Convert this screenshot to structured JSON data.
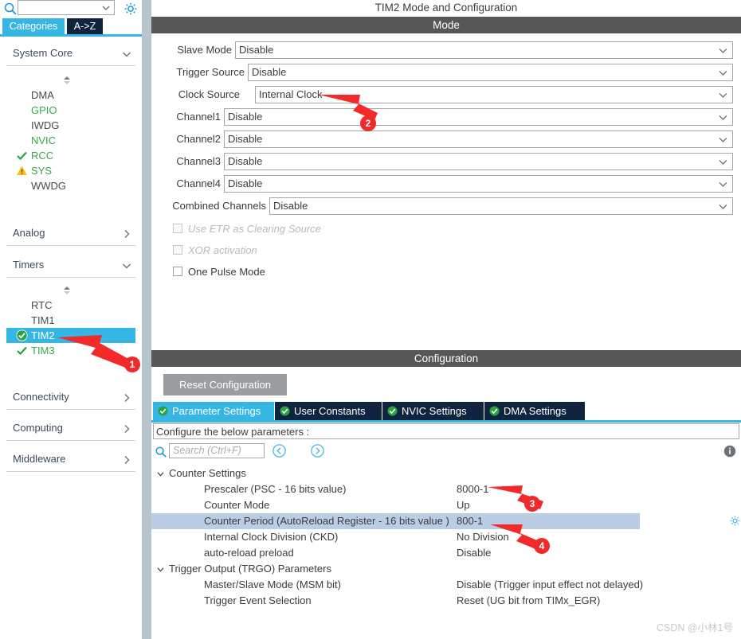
{
  "sidebar": {
    "search": {
      "value": "",
      "placeholder": ""
    },
    "tabs": [
      {
        "label": "Categories",
        "active": true
      },
      {
        "label": "A->Z",
        "active": false
      }
    ],
    "groups": [
      {
        "title": "System Core",
        "expanded": true,
        "items": [
          {
            "label": "DMA",
            "state": "none",
            "selected": false
          },
          {
            "label": "GPIO",
            "state": "green",
            "selected": false
          },
          {
            "label": "IWDG",
            "state": "none",
            "selected": false
          },
          {
            "label": "NVIC",
            "state": "green",
            "selected": false
          },
          {
            "label": "RCC",
            "state": "check",
            "selected": false
          },
          {
            "label": "SYS",
            "state": "warning",
            "selected": false
          },
          {
            "label": "WWDG",
            "state": "none",
            "selected": false
          }
        ]
      },
      {
        "title": "Analog",
        "expanded": false,
        "items": []
      },
      {
        "title": "Timers",
        "expanded": true,
        "items": [
          {
            "label": "RTC",
            "state": "none",
            "selected": false
          },
          {
            "label": "TIM1",
            "state": "none",
            "selected": false
          },
          {
            "label": "TIM2",
            "state": "circle",
            "selected": true
          },
          {
            "label": "TIM3",
            "state": "check",
            "selected": false
          }
        ]
      },
      {
        "title": "Connectivity",
        "expanded": false,
        "items": []
      },
      {
        "title": "Computing",
        "expanded": false,
        "items": []
      },
      {
        "title": "Middleware",
        "expanded": false,
        "items": []
      }
    ]
  },
  "main": {
    "page_title": "TIM2 Mode and Configuration",
    "mode": {
      "header": "Mode",
      "fields": [
        {
          "label": "Slave Mode",
          "value": "Disable"
        },
        {
          "label": "Trigger Source",
          "value": "Disable"
        },
        {
          "label": "Clock Source",
          "value": "Internal Clock"
        },
        {
          "label": "Channel1",
          "value": "Disable"
        },
        {
          "label": "Channel2",
          "value": "Disable"
        },
        {
          "label": "Channel3",
          "value": "Disable"
        },
        {
          "label": "Channel4",
          "value": "Disable"
        },
        {
          "label": "Combined Channels",
          "value": "Disable"
        }
      ],
      "checkboxes": [
        {
          "label": "Use ETR as Clearing Source",
          "checked": false,
          "disabled": true
        },
        {
          "label": "XOR activation",
          "checked": false,
          "disabled": true
        },
        {
          "label": "One Pulse Mode",
          "checked": false,
          "disabled": false
        }
      ]
    },
    "configuration": {
      "header": "Configuration",
      "reset_label": "Reset Configuration",
      "tabs": [
        {
          "label": "Parameter Settings",
          "active": true
        },
        {
          "label": "User Constants",
          "active": false
        },
        {
          "label": "NVIC Settings",
          "active": false
        },
        {
          "label": "DMA Settings",
          "active": false
        }
      ],
      "note": "Configure the below parameters :",
      "search_placeholder": "Search (Ctrl+F)",
      "tree": [
        {
          "type": "group",
          "label": "Counter Settings"
        },
        {
          "type": "param",
          "label": "Prescaler (PSC - 16 bits value)",
          "value": "8000-1",
          "highlight": false
        },
        {
          "type": "param",
          "label": "Counter Mode",
          "value": "Up",
          "highlight": false
        },
        {
          "type": "param",
          "label": "Counter Period (AutoReload Register - 16 bits value )",
          "value": "800-1",
          "highlight": true
        },
        {
          "type": "param",
          "label": "Internal Clock Division (CKD)",
          "value": "No Division",
          "highlight": false
        },
        {
          "type": "param",
          "label": "auto-reload preload",
          "value": "Disable",
          "highlight": false
        },
        {
          "type": "group",
          "label": "Trigger Output (TRGO) Parameters"
        },
        {
          "type": "param",
          "label": "Master/Slave Mode (MSM bit)",
          "value": "Disable (Trigger input effect not delayed)",
          "highlight": false
        },
        {
          "type": "param",
          "label": "Trigger Event Selection",
          "value": "Reset (UG bit from TIMx_EGR)",
          "highlight": false
        }
      ]
    }
  },
  "annotations": [
    {
      "number": "1"
    },
    {
      "number": "2"
    },
    {
      "number": "3"
    },
    {
      "number": "4"
    }
  ],
  "watermark": "CSDN @小林1号",
  "colors": {
    "accent": "#35b6e5",
    "tab_idle": "#10243f",
    "bar_dark": "#575757",
    "annotation": "#f02a2a",
    "green": "#37a84a",
    "warning": "#f4c21a",
    "row_highlight": "#b9cde4"
  }
}
